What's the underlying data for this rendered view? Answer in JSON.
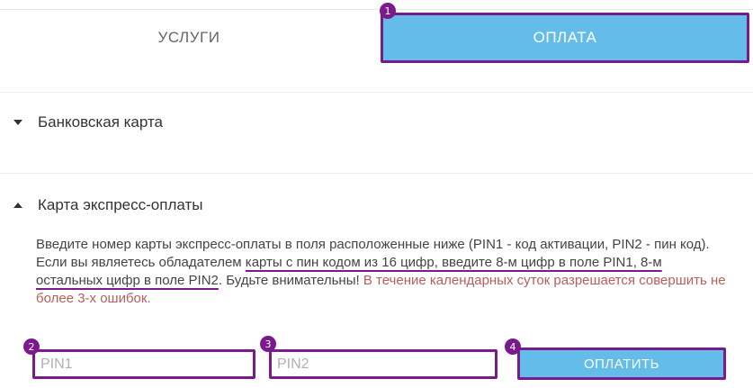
{
  "tabs": {
    "services": "Услуги",
    "payment": "Оплата"
  },
  "sections": {
    "bank_card": "Банковская карта",
    "express_card": "Карта экспресс-оплаты"
  },
  "description": {
    "part1": "Введите номер карты экспресс-оплаты в поля расположенные ниже (PIN1 - код активации, PIN2 - пин код). Если вы являетесь обладателем ",
    "part2_underlined": "карты с пин кодом из 16 цифр, введите 8-м цифр в поле PIN1, 8-м остальных цифр в поле PIN2",
    "part3": ". Будьте внимательны! ",
    "warning": "В течение календарных суток разрешается совершить не более 3-х ошибок."
  },
  "form": {
    "pin1_placeholder": "PIN1",
    "pin1_value": "",
    "pin2_placeholder": "PIN2",
    "pin2_value": "",
    "pay_button": "Оплатить"
  },
  "markers": [
    "1",
    "2",
    "3",
    "4"
  ],
  "colors": {
    "accent": "#63bde8",
    "highlight": "#7b1a8c",
    "warning": "#b85c5c"
  }
}
